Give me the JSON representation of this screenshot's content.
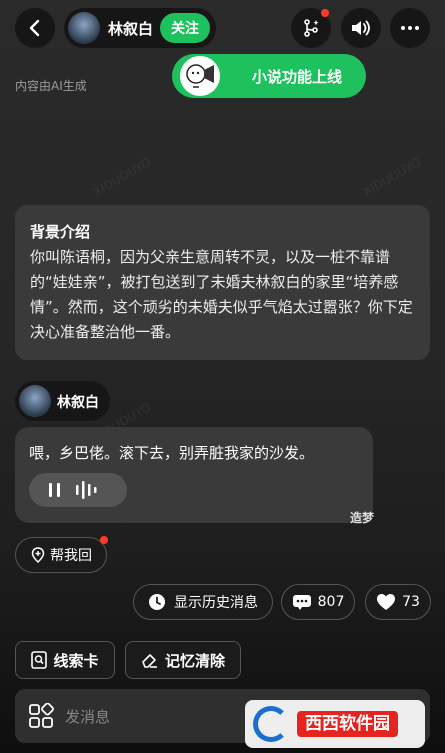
{
  "header": {
    "character_name": "林叙白",
    "follow_label": "关注",
    "ai_notice": "内容由AI生成",
    "toast": "小说功能上线"
  },
  "intro": {
    "title": "背景介绍",
    "body": "你叫陈语桐，因为父亲生意周转不灵，以及一桩不靠谱的“娃娃亲”，被打包送到了未婚夫林叙白的家里“培养感情”。然而，这个顽劣的未婚夫似乎气焰太过嚣张？你下定决心准备整治他一番。"
  },
  "message": {
    "sender": "林叙白",
    "text": "喂，乡巴佬。滚下去，别弄脏我家的沙发。",
    "brand": "造梦"
  },
  "actions": {
    "help_reply": "帮我回",
    "history": "显示历史消息",
    "comments": "807",
    "likes": "73",
    "clue_card": "线索卡",
    "clear_memory": "记忆清除"
  },
  "input": {
    "placeholder": "发消息"
  },
  "watermark": {
    "site": "西西软件园"
  },
  "colors": {
    "accent_green": "#1fc15f",
    "notify_red": "#ff3b30"
  }
}
